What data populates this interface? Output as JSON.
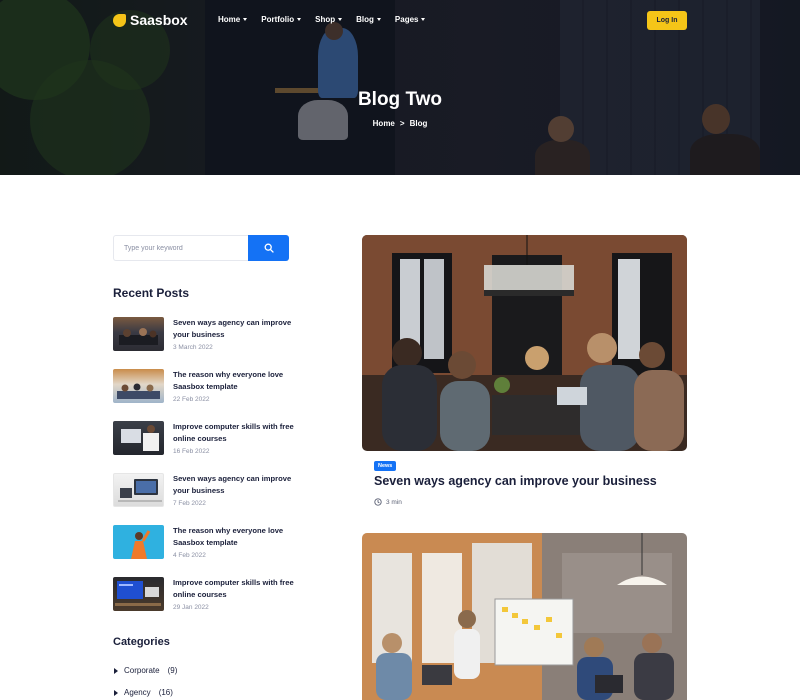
{
  "brand": {
    "name": "Saasbox",
    "accent": "#f5c518",
    "primary": "#1472f5"
  },
  "nav": {
    "items": [
      {
        "label": "Home"
      },
      {
        "label": "Portfolio"
      },
      {
        "label": "Shop"
      },
      {
        "label": "Blog"
      },
      {
        "label": "Pages"
      }
    ],
    "login_label": "Log In"
  },
  "hero": {
    "title": "Blog Two",
    "breadcrumb": {
      "home": "Home",
      "separator": ">",
      "current": "Blog"
    }
  },
  "sidebar": {
    "search": {
      "placeholder": "Type your keyword",
      "icon": "search-icon"
    },
    "recent_heading": "Recent Posts",
    "recent_posts": [
      {
        "title": "Seven ways agency can improve your business",
        "date": "3 March 2022"
      },
      {
        "title": "The reason why everyone love Saasbox template",
        "date": "22 Feb 2022"
      },
      {
        "title": "Improve computer skills with free online courses",
        "date": "16 Feb 2022"
      },
      {
        "title": "Seven ways agency can improve your business",
        "date": "7 Feb 2022"
      },
      {
        "title": "The reason why everyone love Saasbox template",
        "date": "4 Feb 2022"
      },
      {
        "title": "Improve computer skills with free online courses",
        "date": "29 Jan 2022"
      }
    ],
    "categories_heading": "Categories",
    "categories": [
      {
        "name": "Corporate",
        "count": "(9)"
      },
      {
        "name": "Agency",
        "count": "(16)"
      }
    ]
  },
  "articles": [
    {
      "tag": "News",
      "title": "Seven ways agency can improve your business",
      "read_time": "3 min",
      "icon": "clock-icon"
    }
  ]
}
